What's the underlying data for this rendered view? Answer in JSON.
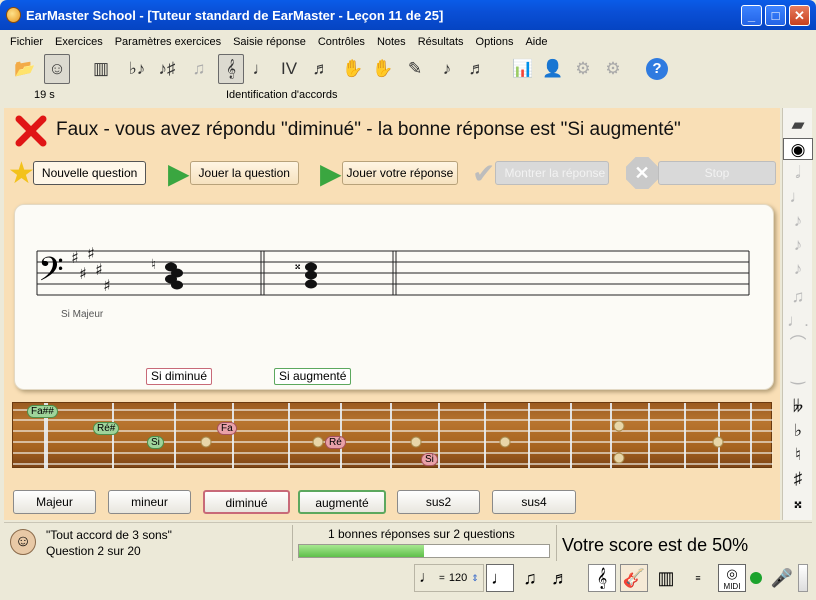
{
  "window": {
    "title": "EarMaster School - [Tuteur standard de EarMaster - Leçon 11 de 25]"
  },
  "menu": [
    "Fichier",
    "Exercices",
    "Paramètres exercices",
    "Saisie réponse",
    "Contrôles",
    "Notes",
    "Résultats",
    "Options",
    "Aide"
  ],
  "toolbar": {
    "time": "19 s",
    "mode": "Identification d'accords"
  },
  "feedback": {
    "text": "Faux - vous avez répondu \"diminué\" - la bonne réponse est \"Si augmenté\""
  },
  "actions": {
    "new_question": "Nouvelle question",
    "play_question": "Jouer la question",
    "play_answer": "Jouer votre réponse",
    "show_answer": "Montrer la réponse",
    "stop": "Stop"
  },
  "staff": {
    "key_label": "Si Majeur",
    "user_chord_label": "Si diminué",
    "correct_chord_label": "Si augmenté"
  },
  "fretboard": {
    "notes": [
      {
        "label": "Fa##",
        "color": "green"
      },
      {
        "label": "Ré#",
        "color": "green"
      },
      {
        "label": "Si",
        "color": "green"
      },
      {
        "label": "Fa",
        "color": "pink"
      },
      {
        "label": "Ré",
        "color": "pink"
      },
      {
        "label": "Si",
        "color": "pink"
      }
    ]
  },
  "answers": [
    {
      "label": "Majeur",
      "state": "normal"
    },
    {
      "label": "mineur",
      "state": "normal"
    },
    {
      "label": "diminué",
      "state": "wrong"
    },
    {
      "label": "augmenté",
      "state": "correct"
    },
    {
      "label": "sus2",
      "state": "normal"
    },
    {
      "label": "sus4",
      "state": "normal"
    }
  ],
  "status": {
    "exercise_name": "\"Tout accord de 3 sons\"",
    "question_progress": "Question 2 sur 20",
    "correct_count": "1 bonnes réponses sur 2 questions",
    "progress_fraction": 0.5,
    "score": "Votre score est de 50%"
  },
  "bottom": {
    "tempo": "120",
    "midi_label": "MIDI"
  },
  "colors": {
    "wrong": "#c86a78",
    "correct": "#5ca85e",
    "progress": "#7ed36a",
    "accent": "#0a4fd6"
  }
}
